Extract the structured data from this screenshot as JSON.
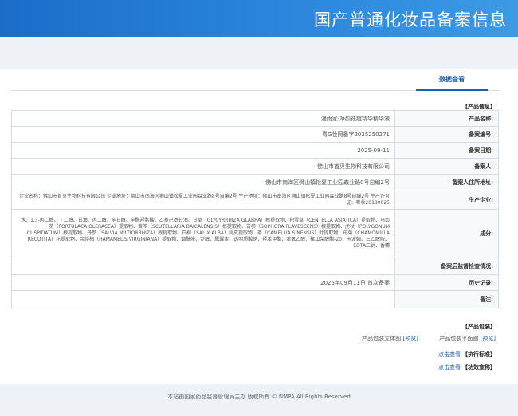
{
  "banner": {
    "title": "国产普通化妆品备案信息"
  },
  "tabs": {
    "active": "数据查看"
  },
  "product_info": {
    "section_title": "【产品信息】",
    "rows": [
      {
        "label": "产品名称:",
        "value": "漫雨家·净颜祛痘精华精华液"
      },
      {
        "label": "备案编号:",
        "value": "粤G妆网备字2025250271"
      },
      {
        "label": "备案日期:",
        "value": "2025-09-11"
      },
      {
        "label": "备案人:",
        "value": "佛山市首贝生物科技有限公司"
      },
      {
        "label": "备案人住所地址:",
        "value": "佛山市南海区狮山镇松夏工业园森业路8号自编2号"
      },
      {
        "label": "生产企业:",
        "value": "企业名称：佛山市首贝生物科技有限公司 企业地址：佛山市南海区狮山镇松夏工业园森业路8号自编2号 生产地址：佛山市南海区狮山镇松夏工业园森业路8号自编2号 生产许可证：粤妆20180025"
      },
      {
        "label": "成分:",
        "value": "水、1,3-丙二醇、丁二醇、甘油、丙二醇、辛甘醇、辛酰羟肟酸、乙基己基甘油、甘草（GLYCYRRHIZA GLABRA）根提取物、积雪草（CENTELLA ASIATICA）提取物、马齿苋（PORTULACA OLERACEA）提取物、黄芩（SCUTELLARIA BAICALENSIS）根提取物、苦参（SOPHORA FLAVESCENS）根提取物、虎杖（POLYGONUM CUSPIDATUM）根提取物、丹参（SALVIA MILTIORRHIZA）根提取物、白柳（SALIX ALBA）树皮提取物、茶（CAMELLIA SINENSIS）叶提取物、母菊（CHAMOMILLA RECUTITA）花提取物、金缕梅（HAMAMELIS VIRGINIANA）提取物、烟酰胺、泛醇、尿囊素、透明质酸钠、羟苯甲酯、苯氧乙醇、聚山梨醇酯-20、卡波姆、三乙醇胺、EDTA二钠、香精"
      },
      {
        "label": "备案后监督检查情况:",
        "value": ""
      },
      {
        "label": "历史记录:",
        "value": "2025年09月11日 首次备案"
      },
      {
        "label": "备注:",
        "value": ""
      }
    ]
  },
  "package_info": {
    "section_title": "【产品包装】",
    "item1_label": "产品包装平面图",
    "item1_link": "[预览]",
    "item2_label": "产品包装立体图",
    "item2_link": "[预览]"
  },
  "standard": {
    "title": "【执行标准】",
    "link": "点击查看"
  },
  "efficacy": {
    "title": "【功效宣称】",
    "link": "点击查看"
  },
  "footer": {
    "text": "本站由国家药品监督管理局主办 版权所有 © NMPA All Rights Reserved"
  }
}
